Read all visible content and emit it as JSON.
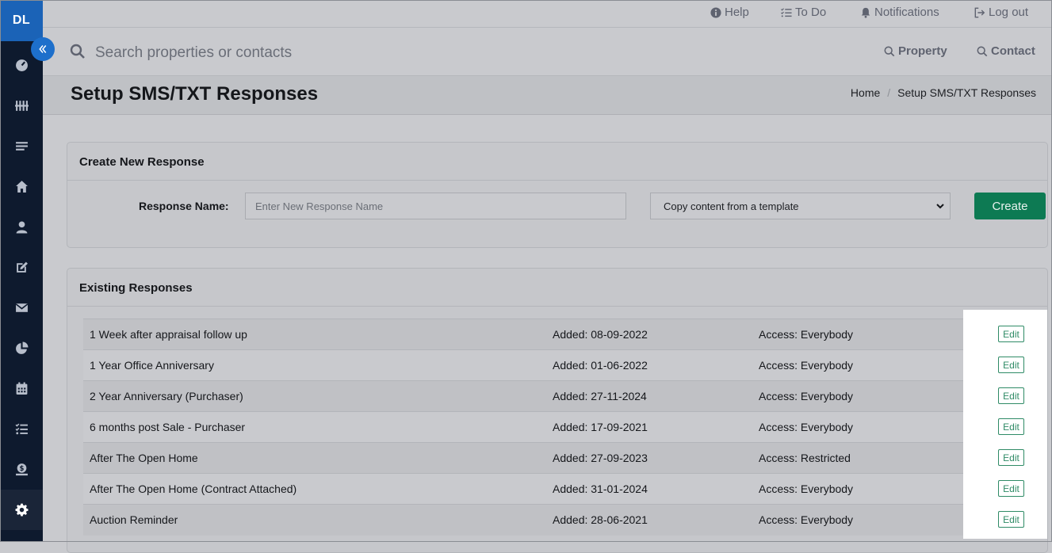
{
  "sidebar": {
    "avatar_initials": "DL",
    "items": [
      "dashboard-icon",
      "listings-icon",
      "menu-icon",
      "home-icon",
      "contacts-icon",
      "edit-icon",
      "mail-icon",
      "reports-icon",
      "calendar-icon",
      "tasks-icon",
      "commission-icon",
      "settings-icon"
    ],
    "active_item": "settings-icon"
  },
  "topbar": {
    "help": "Help",
    "todo": "To Do",
    "notifications": "Notifications",
    "logout": "Log out"
  },
  "search": {
    "placeholder": "Search properties or contacts",
    "property_label": "Property",
    "contact_label": "Contact"
  },
  "header": {
    "title": "Setup SMS/TXT Responses",
    "breadcrumb": [
      "Home",
      "Setup SMS/TXT Responses"
    ]
  },
  "create_card": {
    "title": "Create New Response",
    "field_label": "Response Name:",
    "input_placeholder": "Enter New Response Name",
    "template_select_value": "Copy content from a template",
    "create_button": "Create"
  },
  "existing_card": {
    "title": "Existing Responses",
    "edit_label": "Edit",
    "rows": [
      {
        "name": "1 Week after appraisal follow up",
        "added": "Added: 08-09-2022",
        "access": "Access: Everybody"
      },
      {
        "name": "1 Year Office Anniversary",
        "added": "Added: 01-06-2022",
        "access": "Access: Everybody"
      },
      {
        "name": "2 Year Anniversary (Purchaser)",
        "added": "Added: 27-11-2024",
        "access": "Access: Everybody"
      },
      {
        "name": "6 months post Sale - Purchaser",
        "added": "Added: 17-09-2021",
        "access": "Access: Everybody"
      },
      {
        "name": "After The Open Home",
        "added": "Added: 27-09-2023",
        "access": "Access: Restricted"
      },
      {
        "name": "After The Open Home (Contract Attached)",
        "added": "Added: 31-01-2024",
        "access": "Access: Everybody"
      },
      {
        "name": "Auction Reminder",
        "added": "Added: 28-06-2021",
        "access": "Access: Everybody"
      }
    ]
  },
  "colors": {
    "sidebar_bg": "#0e1a2e",
    "avatar_bg": "#1b63b7",
    "create_button_bg": "#0d7a53",
    "edit_button": "#2f8b66"
  }
}
